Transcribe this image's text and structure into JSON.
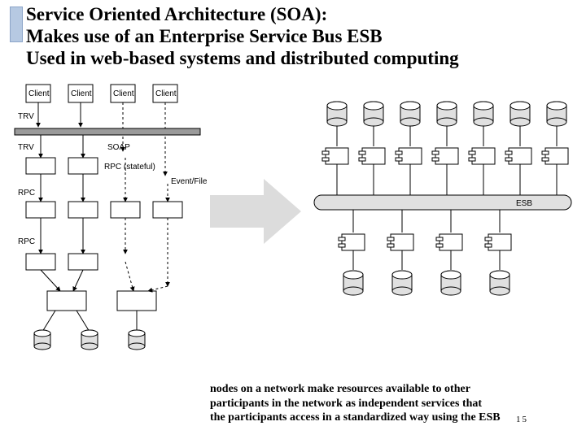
{
  "title": {
    "l1": "Service Oriented Architecture (SOA):",
    "l2": "Makes use of an Enterprise Service Bus ESB",
    "l3": "Used in web-based systems and distributed computing"
  },
  "left": {
    "clients": [
      "Client",
      "Client",
      "Client",
      "Client"
    ],
    "trv1": "TRV",
    "trv2": "TRV",
    "soap": "SOAP",
    "rpc_state": "RPC (stateful)",
    "event": "Event/File",
    "rpc1": "RPC",
    "rpc2": "RPC"
  },
  "esb": {
    "label": "ESB"
  },
  "caption": {
    "l1": "nodes on a network make resources available to other",
    "l2": "participants in the network as independent services that",
    "l3": " the participants access in a standardized way using the  ESB"
  },
  "page": "15"
}
